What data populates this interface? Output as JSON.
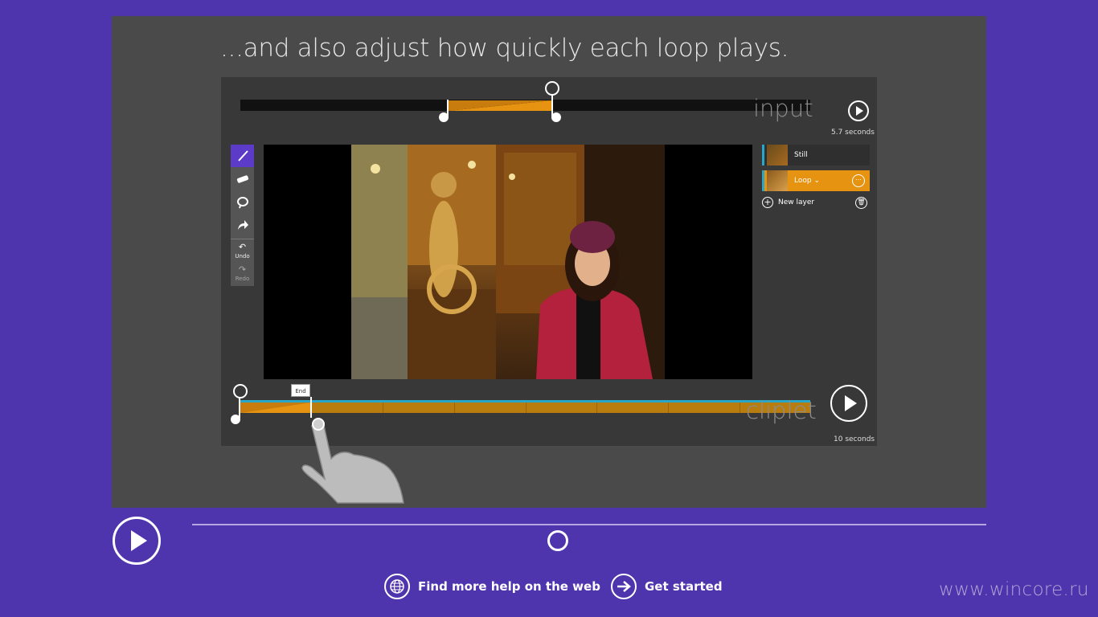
{
  "headline": "...and also adjust how quickly each loop plays.",
  "input_timeline": {
    "label": "input",
    "duration": "5.7 seconds"
  },
  "cliplet_timeline": {
    "label": "cliplet",
    "duration": "10 seconds",
    "end_tag": "End"
  },
  "tools": {
    "undo": "Undo",
    "redo": "Redo"
  },
  "layers": [
    {
      "name": "Still"
    },
    {
      "name": "Loop ⌄"
    }
  ],
  "new_layer": "New layer",
  "links": {
    "help": "Find more help on the web",
    "start": "Get started"
  },
  "watermark": "www.wincore.ru",
  "colors": {
    "background": "#4f35ad",
    "panel": "#4a4a4a",
    "accent_orange": "#e69312",
    "accent_blue": "#27a7c9",
    "tool_active": "#5b3bc8"
  }
}
